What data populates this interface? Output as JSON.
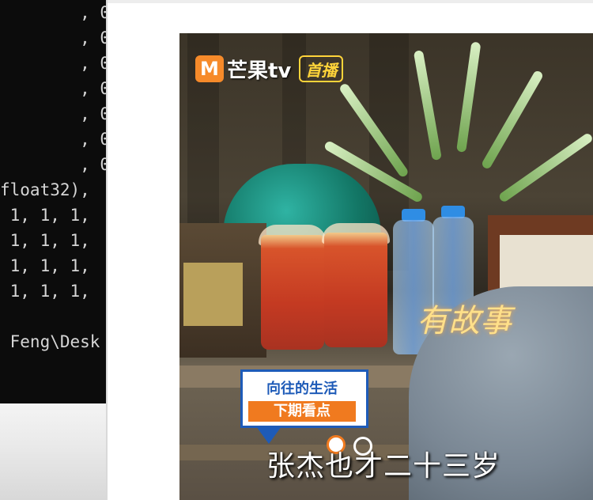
{
  "terminal": {
    "lines": [
      "        , 0.",
      "        , 0.",
      "        , 0.",
      "        , 0.",
      "        , 0.",
      "        , 0.",
      "        , 0.",
      "float32),",
      " 1, 1, 1,",
      " 1, 1, 1,",
      " 1, 1, 1,",
      " 1, 1, 1,",
      "",
      " Feng\\Desk"
    ]
  },
  "video": {
    "logo_letter": "M",
    "logo_text": "芒果tv",
    "logo_badge": "首播",
    "overlay_tag": "有故事",
    "promo_title": "向往的生活",
    "promo_subtitle": "下期看点",
    "subtitle": "张杰也才二十三岁",
    "colors": {
      "logo_orange": "#f68a2a",
      "badge_yellow": "#ffd43a",
      "promo_blue": "#1e5bb8",
      "promo_orange": "#f07a1f"
    }
  }
}
